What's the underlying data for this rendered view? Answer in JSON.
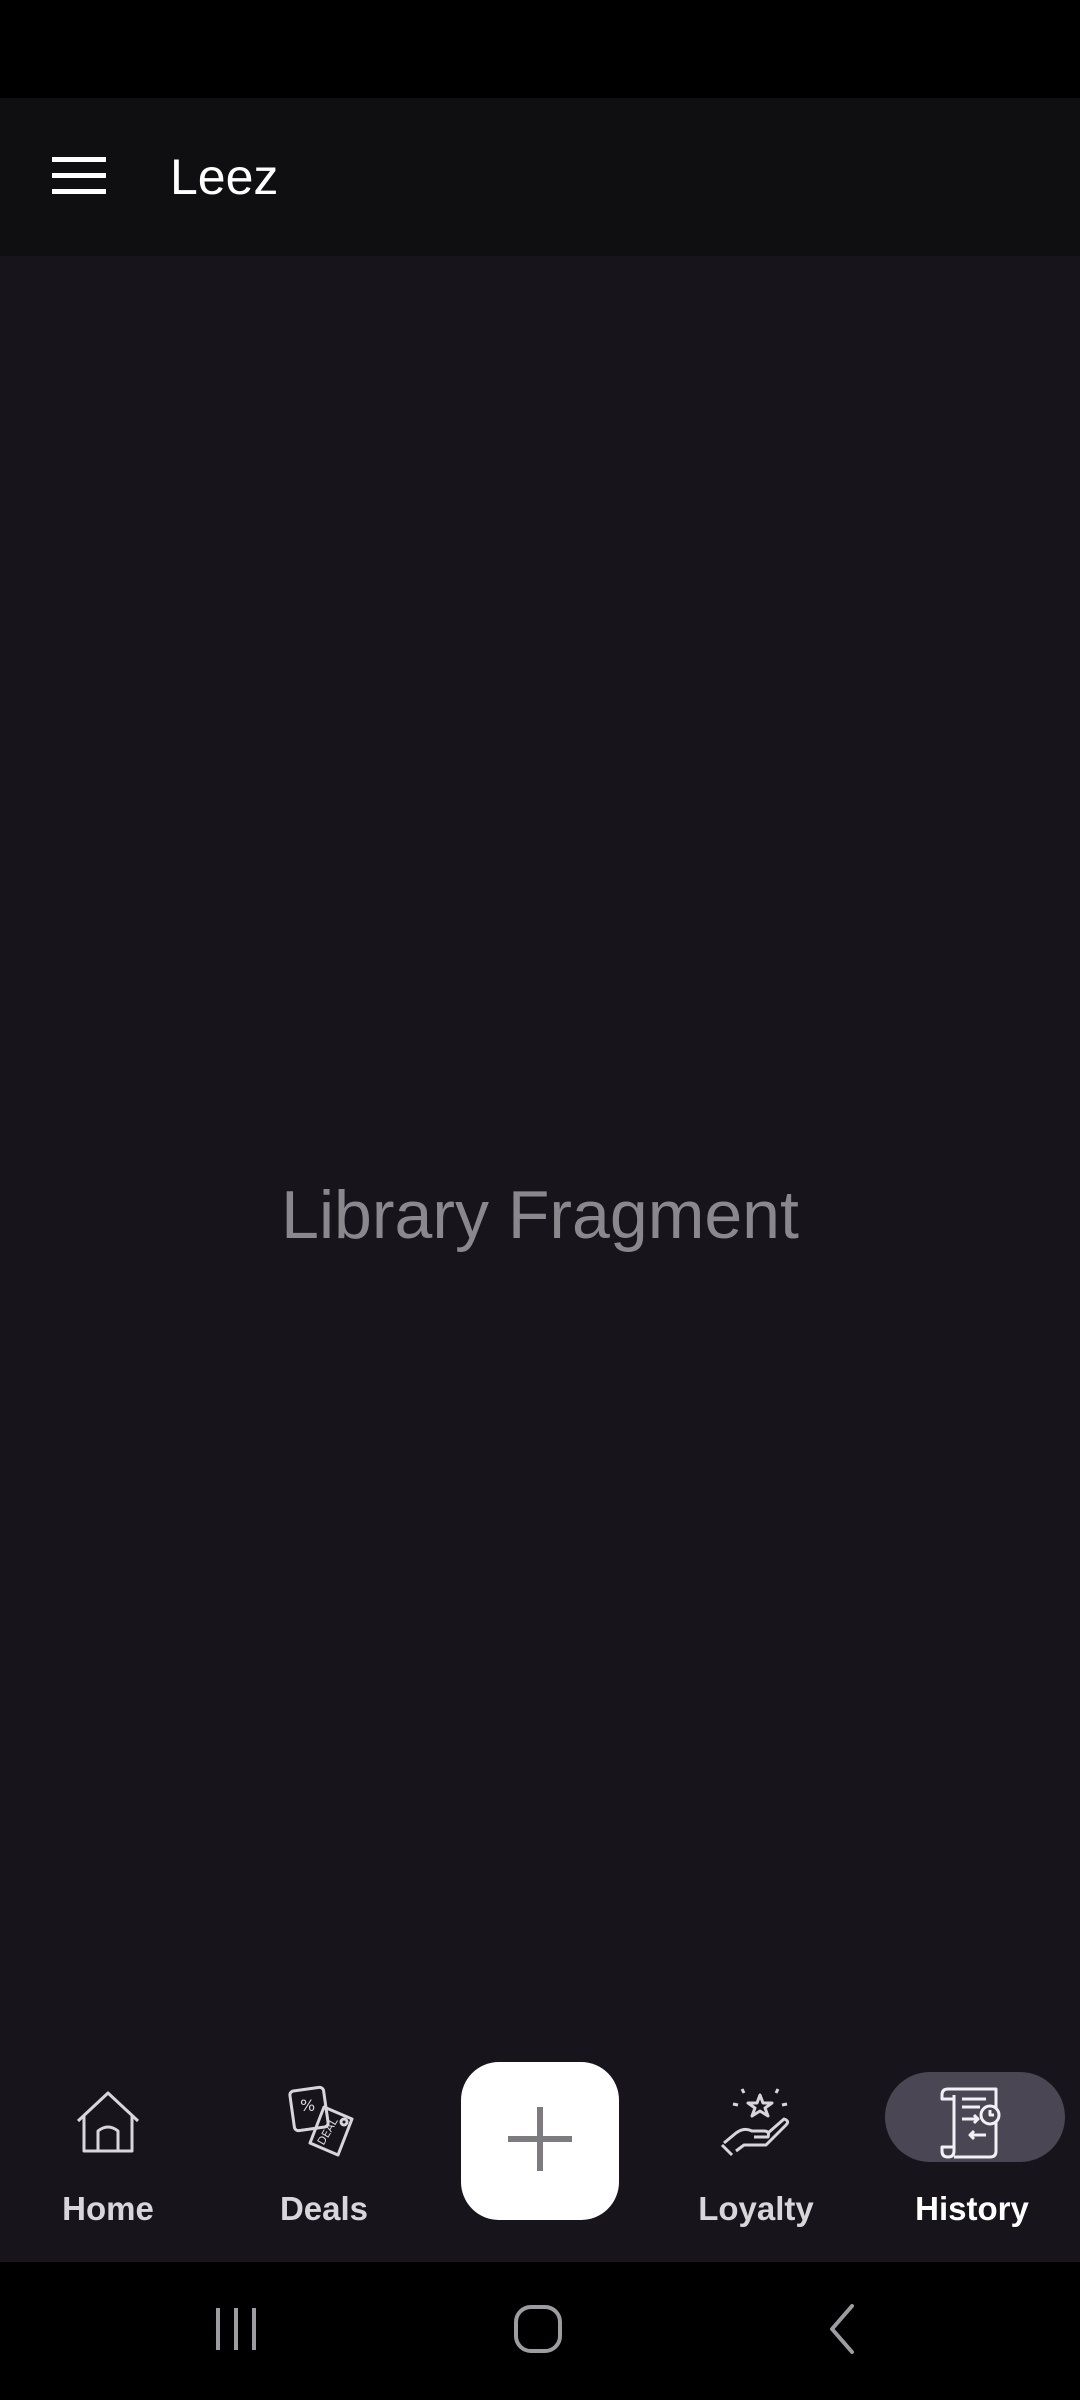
{
  "app_bar": {
    "title": "Leez",
    "menu_icon": "hamburger-menu-icon"
  },
  "content": {
    "placeholder_text": "Library Fragment"
  },
  "bottom_nav": {
    "items": [
      {
        "label": "Home",
        "icon": "home-icon",
        "active": false
      },
      {
        "label": "Deals",
        "icon": "deal-tag-icon",
        "active": false
      },
      {
        "label": "Loyalty",
        "icon": "hand-star-icon",
        "active": false
      },
      {
        "label": "History",
        "icon": "history-scroll-icon",
        "active": true
      }
    ],
    "fab_icon": "plus-icon"
  },
  "system_nav": {
    "icons": [
      "recents-icon",
      "home-circle-icon",
      "back-icon"
    ]
  },
  "colors": {
    "background": "#17151b",
    "app_bar": "#0f0e10",
    "active_pill": "#4a4653",
    "placeholder_text": "#8a888d"
  }
}
